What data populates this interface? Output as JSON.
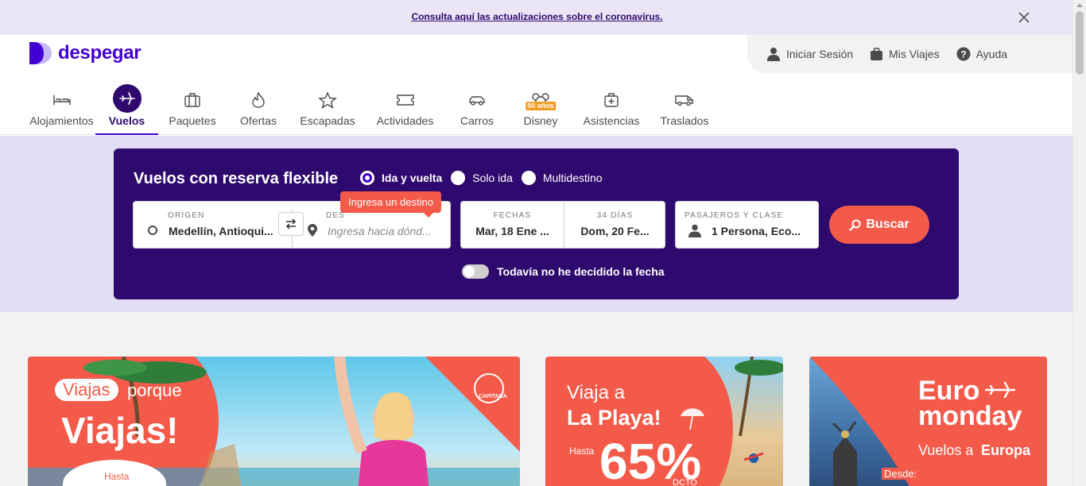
{
  "banner": {
    "link_text": "Consulta aquí las actualizaciones sobre el coronavirus."
  },
  "header": {
    "logo_text": "despegar",
    "user_menu": [
      {
        "label": "Iniciar Sesión",
        "icon": "user-icon"
      },
      {
        "label": "Mis Viajes",
        "icon": "suitcase-icon"
      },
      {
        "label": "Ayuda",
        "icon": "help-icon"
      }
    ]
  },
  "nav": {
    "items": [
      {
        "label": "Alojamientos",
        "icon": "bed-icon"
      },
      {
        "label": "Vuelos",
        "icon": "plane-icon",
        "active": true
      },
      {
        "label": "Paquetes",
        "icon": "bag-icon"
      },
      {
        "label": "Ofertas",
        "icon": "flame-icon"
      },
      {
        "label": "Escapadas",
        "icon": "star-icon"
      },
      {
        "label": "Actividades",
        "icon": "ticket-icon"
      },
      {
        "label": "Carros",
        "icon": "car-icon"
      },
      {
        "label": "Disney",
        "icon": "mickey-icon",
        "badge": "50 años"
      },
      {
        "label": "Asistencias",
        "icon": "medical-kit-icon"
      },
      {
        "label": "Traslados",
        "icon": "shuttle-icon"
      }
    ]
  },
  "search": {
    "title": "Vuelos con reserva flexible",
    "trip_types": [
      {
        "label": "Ida y vuelta",
        "checked": true
      },
      {
        "label": "Solo ida",
        "checked": false
      },
      {
        "label": "Multidestino",
        "checked": false
      }
    ],
    "origin_label": "ORIGEN",
    "origin_value": "Medellín, Antioqui...",
    "destination_label": "DES",
    "destination_placeholder": "Ingresa hacia dónd...",
    "tooltip": "Ingresa un destino",
    "dates_label": "FECHAS",
    "date_from": "Mar, 18 Ene ...",
    "days_label": "34 DÍAS",
    "date_to": "Dom, 20 Fe...",
    "passengers_label": "PASAJEROS Y CLASE",
    "passengers_value": "1 Persona, Eco...",
    "search_button": "Buscar",
    "flexible_toggle_label": "Todavía no he decidido la fecha"
  },
  "promos": [
    {
      "line1": "Viajas",
      "line1b": "porque",
      "line2": "Viajas!",
      "line3": "Hasta",
      "logo": "CAPITANA"
    },
    {
      "line1": "Viaja a",
      "line2": "La Playa!",
      "line3": "Hasta",
      "big": "65%",
      "small": "DCTO"
    },
    {
      "line1": "Euro",
      "line2": "monday",
      "line3a": "Vuelos a",
      "line3b": "Europa",
      "line4": "Desde:"
    }
  ],
  "colors": {
    "brand": "#4300d2",
    "search_bg": "#2f0a6e",
    "accent": "#f45a4a",
    "band": "#e3ddf5"
  }
}
